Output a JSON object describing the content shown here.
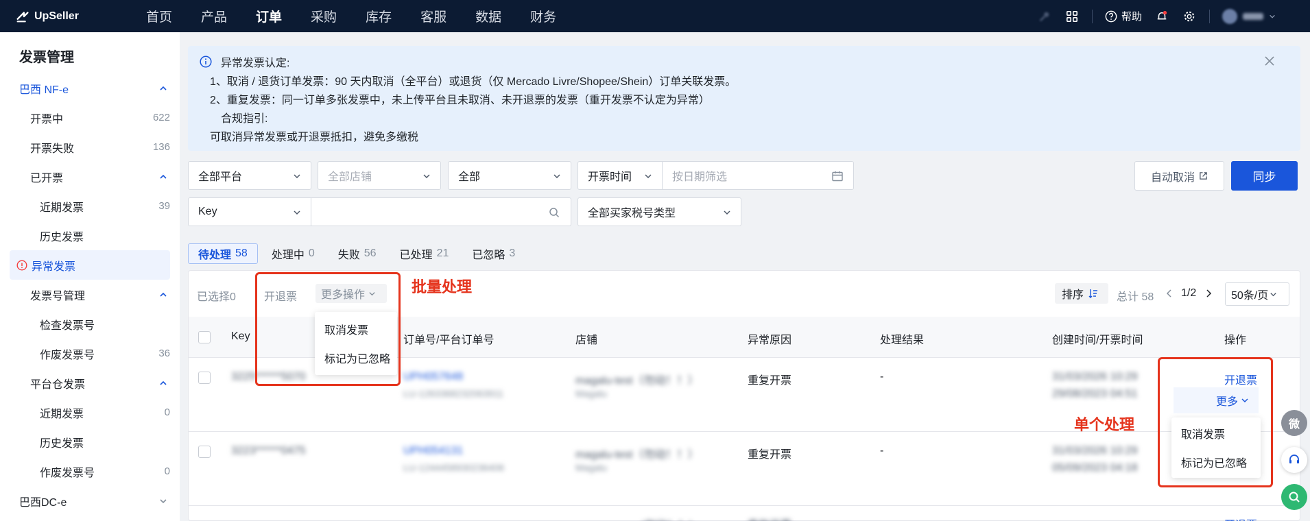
{
  "brand": {
    "name": "UpSeller"
  },
  "nav": [
    {
      "label": "首页"
    },
    {
      "label": "产品"
    },
    {
      "label": "订单"
    },
    {
      "label": "采购"
    },
    {
      "label": "库存"
    },
    {
      "label": "客服"
    },
    {
      "label": "数据"
    },
    {
      "label": "财务"
    }
  ],
  "nav_active_index": 2,
  "header": {
    "help": "帮助"
  },
  "sidebar": {
    "title": "发票管理",
    "items": [
      {
        "label": "巴西 NF-e",
        "level": 1,
        "expanded": true
      },
      {
        "label": "开票中",
        "level": 2,
        "count": "622"
      },
      {
        "label": "开票失败",
        "level": 2,
        "count": "136"
      },
      {
        "label": "已开票",
        "level": 2,
        "expanded": true
      },
      {
        "label": "近期发票",
        "level": 3,
        "count": "39"
      },
      {
        "label": "历史发票",
        "level": 3
      },
      {
        "label": "异常发票",
        "level": 2,
        "active": true
      },
      {
        "label": "发票号管理",
        "level": 2,
        "expanded": true
      },
      {
        "label": "检查发票号",
        "level": 3
      },
      {
        "label": "作废发票号",
        "level": 3,
        "count": "36"
      },
      {
        "label": "平台仓发票",
        "level": 2,
        "expanded": true
      },
      {
        "label": "近期发票",
        "level": 3,
        "count": "0"
      },
      {
        "label": "历史发票",
        "level": 3
      },
      {
        "label": "作废发票号",
        "level": 3,
        "count": "0"
      },
      {
        "label": "巴西DC-e",
        "level": 1,
        "expanded": false
      }
    ]
  },
  "notice": {
    "lines": [
      "异常发票认定:",
      "1、取消 / 退货订单发票：90 天内取消（全平台）或退货（仅 Mercado Livre/Shopee/Shein）订单关联发票。",
      "2、重复发票：同一订单多张发票中，未上传平台且未取消、未开退票的发票（重开发票不认定为异常）",
      "合规指引:",
      "可取消异常发票或开退票抵扣，避免多缴税"
    ]
  },
  "filters": {
    "platform": "全部平台",
    "store_placeholder": "全部店铺",
    "status": "全部",
    "time_type": "开票时间",
    "date_placeholder": "按日期筛选",
    "key_type": "Key",
    "search_value": "",
    "buyer_tax": "全部买家税号类型",
    "auto_cancel": "自动取消",
    "sync": "同步"
  },
  "tabs": [
    {
      "label": "待处理",
      "count": "58",
      "active": true
    },
    {
      "label": "处理中",
      "count": "0"
    },
    {
      "label": "失败",
      "count": "56"
    },
    {
      "label": "已处理",
      "count": "21"
    },
    {
      "label": "已忽略",
      "count": "3"
    }
  ],
  "toolbar": {
    "selected": "已选择0",
    "refund": "开退票",
    "more": "更多操作",
    "sort": "排序",
    "total": "总计 58",
    "page": "1/2",
    "page_size": "50条/页"
  },
  "batch_menu": [
    "取消发票",
    "标记为已忽略"
  ],
  "row_menu": [
    "取消发票",
    "标记为已忽略"
  ],
  "annotations": {
    "batch": "批量处理",
    "single": "单个处理"
  },
  "table": {
    "columns": [
      "Key",
      "订单号/平台订单号",
      "店铺",
      "异常原因",
      "处理结果",
      "创建时间/开票时间",
      "操作"
    ],
    "rows": [
      {
        "key": "3225******5070",
        "order": "UPH057648",
        "platform_order": "LU-1263368232063911",
        "store": "magalu-test（勿动！！）",
        "store_platform": "Magalu",
        "reason": "重复开票",
        "result": "-",
        "created": "31/03/2026 10:29",
        "issued": "29/08/2023 04:51",
        "action": "开退票",
        "more": "更多"
      },
      {
        "key": "3223******0475",
        "order": "UPH054131",
        "platform_order": "LU-1244458930236406",
        "store": "magalu-test（勿动！！）",
        "store_platform": "Magalu",
        "reason": "重复开票",
        "result": "-",
        "created": "31/03/2026 10:29",
        "issued": "05/09/2023 04:18",
        "action": "开退票"
      }
    ],
    "partial_row": {
      "store": "(勿动！！)",
      "reason": "重复开票",
      "action": "开退票"
    }
  },
  "fab": {
    "wechat": "微"
  },
  "colors": {
    "nav_bg": "#0c1b33",
    "primary": "#1a56db",
    "annotation": "#e5341d",
    "notice_bg": "#e6f0fc"
  }
}
